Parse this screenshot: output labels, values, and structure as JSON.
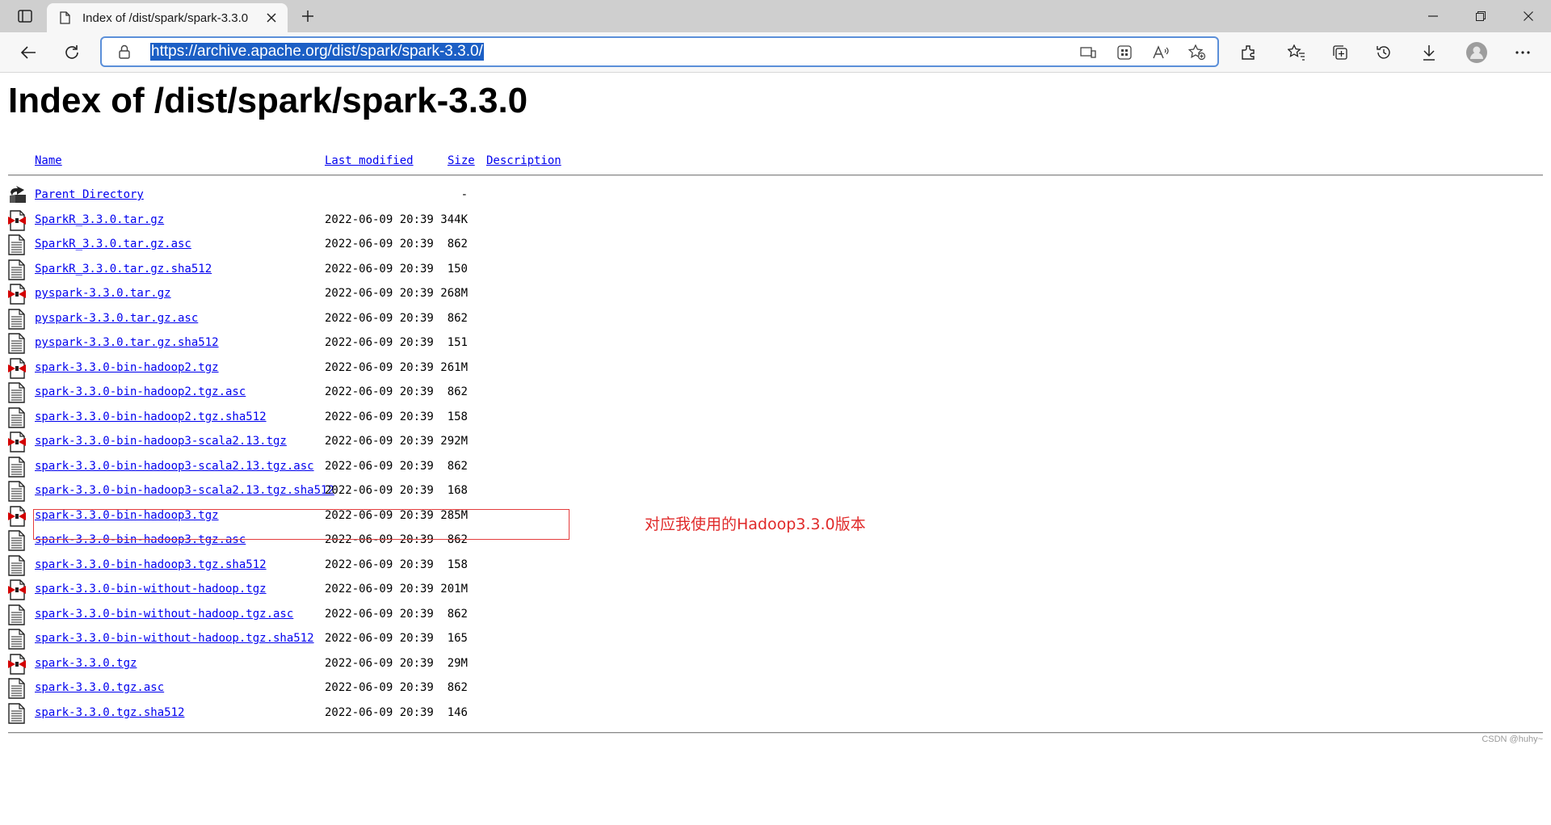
{
  "browser": {
    "tab_title": "Index of /dist/spark/spark-3.3.0",
    "url": "https://archive.apache.org/dist/spark/spark-3.3.0/"
  },
  "page": {
    "title": "Index of /dist/spark/spark-3.3.0",
    "columns": {
      "name": "Name",
      "last_modified": "Last modified",
      "size": "Size",
      "description": "Description"
    },
    "parent": {
      "name": "Parent Directory",
      "size": "-"
    },
    "files": [
      {
        "name": "SparkR_3.3.0.tar.gz",
        "modified": "2022-06-09 20:39",
        "size": "344K",
        "icon": "archive-file-icon"
      },
      {
        "name": "SparkR_3.3.0.tar.gz.asc",
        "modified": "2022-06-09 20:39",
        "size": "862",
        "icon": "text-file-icon"
      },
      {
        "name": "SparkR_3.3.0.tar.gz.sha512",
        "modified": "2022-06-09 20:39",
        "size": "150",
        "icon": "text-file-icon"
      },
      {
        "name": "pyspark-3.3.0.tar.gz",
        "modified": "2022-06-09 20:39",
        "size": "268M",
        "icon": "archive-file-icon"
      },
      {
        "name": "pyspark-3.3.0.tar.gz.asc",
        "modified": "2022-06-09 20:39",
        "size": "862",
        "icon": "text-file-icon"
      },
      {
        "name": "pyspark-3.3.0.tar.gz.sha512",
        "modified": "2022-06-09 20:39",
        "size": "151",
        "icon": "text-file-icon"
      },
      {
        "name": "spark-3.3.0-bin-hadoop2.tgz",
        "modified": "2022-06-09 20:39",
        "size": "261M",
        "icon": "archive-file-icon"
      },
      {
        "name": "spark-3.3.0-bin-hadoop2.tgz.asc",
        "modified": "2022-06-09 20:39",
        "size": "862",
        "icon": "text-file-icon"
      },
      {
        "name": "spark-3.3.0-bin-hadoop2.tgz.sha512",
        "modified": "2022-06-09 20:39",
        "size": "158",
        "icon": "text-file-icon"
      },
      {
        "name": "spark-3.3.0-bin-hadoop3-scala2.13.tgz",
        "modified": "2022-06-09 20:39",
        "size": "292M",
        "icon": "archive-file-icon"
      },
      {
        "name": "spark-3.3.0-bin-hadoop3-scala2.13.tgz.asc",
        "modified": "2022-06-09 20:39",
        "size": "862",
        "icon": "text-file-icon"
      },
      {
        "name": "spark-3.3.0-bin-hadoop3-scala2.13.tgz.sha512",
        "modified": "2022-06-09 20:39",
        "size": "168",
        "icon": "text-file-icon"
      },
      {
        "name": "spark-3.3.0-bin-hadoop3.tgz",
        "modified": "2022-06-09 20:39",
        "size": "285M",
        "icon": "archive-file-icon"
      },
      {
        "name": "spark-3.3.0-bin-hadoop3.tgz.asc",
        "modified": "2022-06-09 20:39",
        "size": "862",
        "icon": "text-file-icon"
      },
      {
        "name": "spark-3.3.0-bin-hadoop3.tgz.sha512",
        "modified": "2022-06-09 20:39",
        "size": "158",
        "icon": "text-file-icon"
      },
      {
        "name": "spark-3.3.0-bin-without-hadoop.tgz",
        "modified": "2022-06-09 20:39",
        "size": "201M",
        "icon": "archive-file-icon"
      },
      {
        "name": "spark-3.3.0-bin-without-hadoop.tgz.asc",
        "modified": "2022-06-09 20:39",
        "size": "862",
        "icon": "text-file-icon"
      },
      {
        "name": "spark-3.3.0-bin-without-hadoop.tgz.sha512",
        "modified": "2022-06-09 20:39",
        "size": "165",
        "icon": "text-file-icon"
      },
      {
        "name": "spark-3.3.0.tgz",
        "modified": "2022-06-09 20:39",
        "size": "29M",
        "icon": "archive-file-icon"
      },
      {
        "name": "spark-3.3.0.tgz.asc",
        "modified": "2022-06-09 20:39",
        "size": "862",
        "icon": "text-file-icon"
      },
      {
        "name": "spark-3.3.0.tgz.sha512",
        "modified": "2022-06-09 20:39",
        "size": "146",
        "icon": "text-file-icon"
      }
    ],
    "annotation": "对应我使用的Hadoop3.3.0版本",
    "highlight_color": "#e43c3c"
  },
  "watermark": "CSDN @huhy~",
  "colors": {
    "link": "#0000ee",
    "url_selection": "#1c5fc5",
    "address_border": "#5b8fd9"
  }
}
